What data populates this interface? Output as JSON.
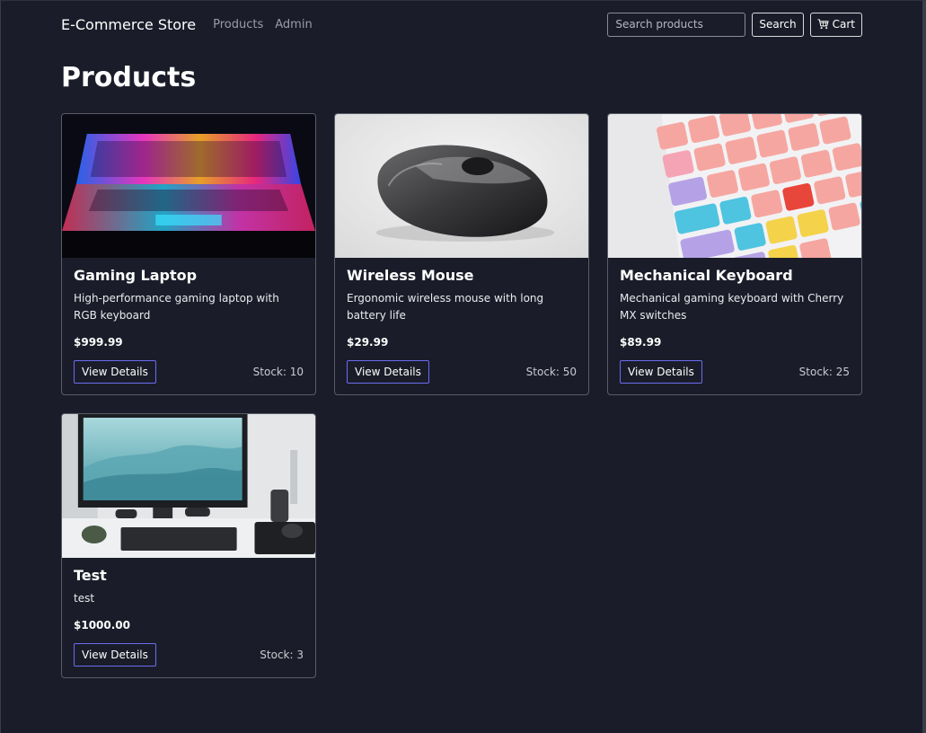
{
  "nav": {
    "brand": "E-Commerce Store",
    "links": [
      "Products",
      "Admin"
    ],
    "search_placeholder": "Search products",
    "search_button": "Search",
    "cart_label": "Cart"
  },
  "page_title": "Products",
  "products": [
    {
      "title": "Gaming Laptop",
      "description": "High-performance gaming laptop with RGB keyboard",
      "price": "$999.99",
      "button": "View Details",
      "stock": "Stock: 10",
      "image": "laptop-image"
    },
    {
      "title": "Wireless Mouse",
      "description": "Ergonomic wireless mouse with long battery life",
      "price": "$29.99",
      "button": "View Details",
      "stock": "Stock: 50",
      "image": "mouse-image"
    },
    {
      "title": "Mechanical Keyboard",
      "description": "Mechanical gaming keyboard with Cherry MX switches",
      "price": "$89.99",
      "button": "View Details",
      "stock": "Stock: 25",
      "image": "keyboard-image"
    },
    {
      "title": "Test",
      "description": "test",
      "price": "$1000.00",
      "button": "View Details",
      "stock": "Stock: 3",
      "image": "desk-setup-image"
    }
  ],
  "colors": {
    "background": "#1a1d29",
    "card_border": "#5a5d68",
    "accent_button_border": "#6b6cf0",
    "muted_text": "#9a9ca6"
  }
}
